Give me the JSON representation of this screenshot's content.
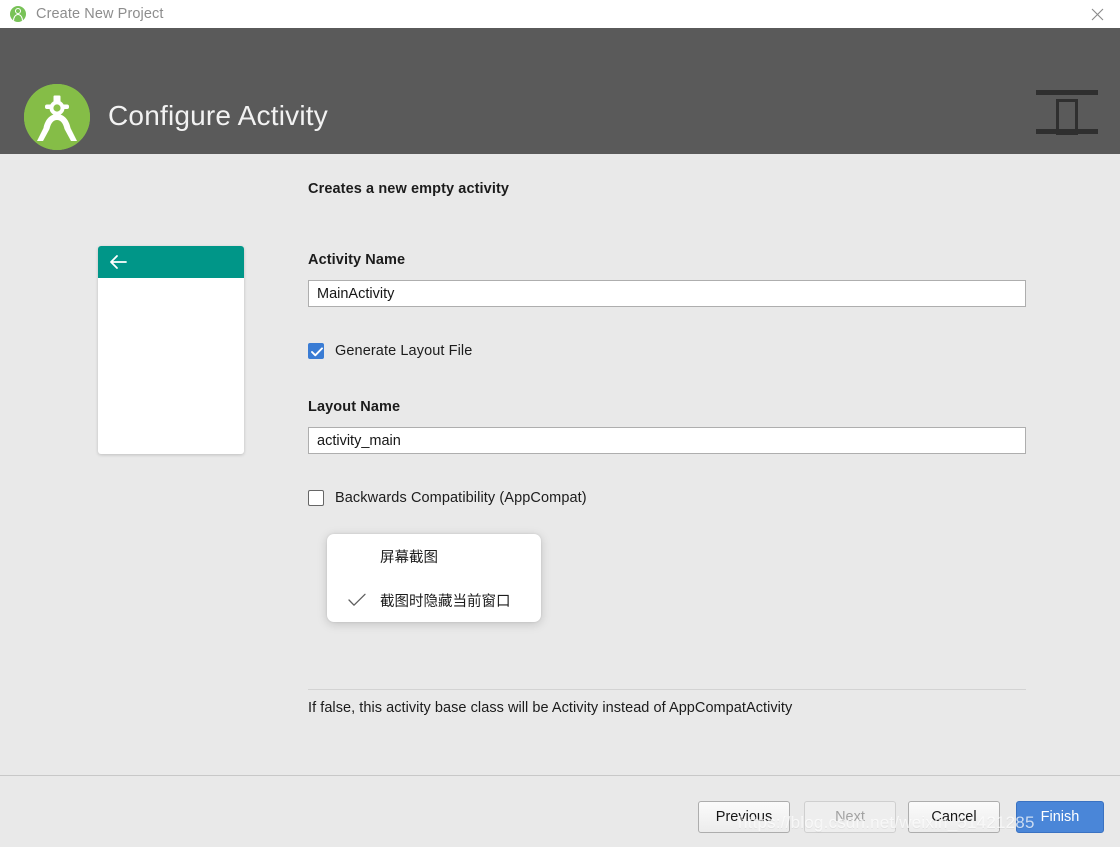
{
  "titlebar": {
    "title": "Create New Project",
    "app_icon": "android-studio-icon",
    "close_icon": "close-icon"
  },
  "header": {
    "title": "Configure Activity",
    "logo_icon": "android-studio-logo",
    "template_icon": "activity-template-icon"
  },
  "preview": {
    "back_icon": "arrow-left-icon",
    "appbar_color": "#009688"
  },
  "form": {
    "description": "Creates a new empty activity",
    "activity_name": {
      "label": "Activity Name",
      "value": "MainActivity",
      "placeholder": "Activity Name"
    },
    "generate_layout": {
      "label": "Generate Layout File",
      "checked": "true"
    },
    "layout_name": {
      "label": "Layout Name",
      "value": "activity_main",
      "placeholder": "Layout Name"
    },
    "backwards_compatibility": {
      "label": "Backwards Compatibility (AppCompat)",
      "checked": "false"
    },
    "help_text": "If false, this activity base class will be Activity instead of AppCompatActivity"
  },
  "popup_menu": {
    "items": [
      {
        "label": "屏幕截图",
        "checked": "false"
      },
      {
        "label": "截图时隐藏当前窗口",
        "checked": "true"
      }
    ],
    "check_icon": "check-icon"
  },
  "footer": {
    "previous_label": "Previous",
    "next_label": "Next",
    "cancel_label": "Cancel",
    "finish_label": "Finish"
  },
  "watermark": {
    "text": "https://blog.csdn.net/weixin_51421285"
  },
  "colors": {
    "accent_blue": "#4a86d8",
    "checkbox_blue": "#3a7cd4",
    "header_gray": "#5a5a5a",
    "teal": "#009688",
    "logo_green": "#7dc45a"
  }
}
